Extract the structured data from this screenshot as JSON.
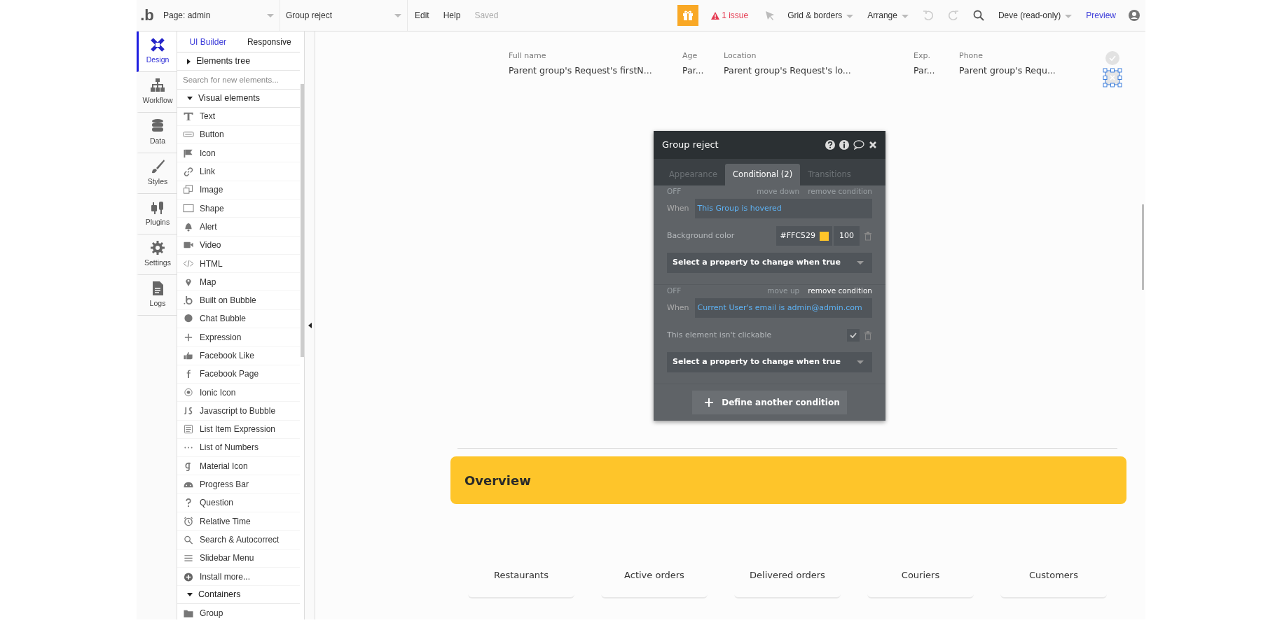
{
  "topbar": {
    "logo": ".b",
    "page": "Page: admin",
    "element": "Group reject",
    "menu": [
      "Edit",
      "Help"
    ],
    "saved": "Saved",
    "issues": "1 issue",
    "grid": "Grid & borders",
    "arrange": "Arrange",
    "user": "Deve (read-only)",
    "preview": "Preview"
  },
  "side_tabs": [
    {
      "label": "Design",
      "selected": true
    },
    {
      "label": "Workflow",
      "selected": false
    },
    {
      "label": "Data",
      "selected": false
    },
    {
      "label": "Styles",
      "selected": false
    },
    {
      "label": "Plugins",
      "selected": false
    },
    {
      "label": "Settings",
      "selected": false
    },
    {
      "label": "Logs",
      "selected": false
    }
  ],
  "panel_tabs": [
    {
      "label": "UI Builder",
      "selected": true
    },
    {
      "label": "Responsive",
      "selected": false
    }
  ],
  "elements_tree": {
    "label": "Elements tree",
    "expanded": false
  },
  "search": {
    "placeholder": "Search for new elements..."
  },
  "sections": [
    {
      "label": "Visual elements",
      "expanded": true,
      "items": [
        "Text",
        "Button",
        "Icon",
        "Link",
        "Image",
        "Shape",
        "Alert",
        "Video",
        "HTML",
        "Map",
        "Built on Bubble",
        "Chat Bubble",
        "Expression",
        "Facebook Like",
        "Facebook Page",
        "Ionic Icon",
        "Javascript to Bubble",
        "List Item Expression",
        "List of Numbers",
        "Material Icon",
        "Progress Bar",
        "Question",
        "Relative Time",
        "Search & Autocorrect",
        "Slidebar Menu",
        "Install more..."
      ]
    },
    {
      "label": "Containers",
      "expanded": true,
      "items": [
        "Group"
      ]
    }
  ],
  "columns": [
    {
      "label": "Full name",
      "value": "Parent group's Request's firstN..."
    },
    {
      "label": "Age",
      "value": "Par..."
    },
    {
      "label": "Location",
      "value": "Parent group's Request's lo..."
    },
    {
      "label": "Exp.",
      "value": "Par..."
    },
    {
      "label": "Phone",
      "value": "Parent group's Requ..."
    }
  ],
  "dialog": {
    "title": "Group reject",
    "tabs": [
      {
        "label": "Appearance",
        "selected": false
      },
      {
        "label": "Conditional (2)",
        "selected": true
      },
      {
        "label": "Transitions",
        "selected": false
      }
    ],
    "conditions": [
      {
        "state": "OFF",
        "move": "move down",
        "remove": "remove condition",
        "remove_hovered": false,
        "when_label": "When",
        "when": "This Group is hovered",
        "property": {
          "kind": "color",
          "label": "Background color",
          "value": "#FFC529",
          "color": "#ffc529",
          "opacity": "100"
        },
        "select": "Select a property to change when true"
      },
      {
        "state": "OFF",
        "move": "move up",
        "remove": "remove condition",
        "remove_hovered": true,
        "when_label": "When",
        "when": "Current User's email is admin@admin.com",
        "property": {
          "kind": "checkbox",
          "label": "This element isn't clickable",
          "checked": true
        },
        "select": "Select a property to change when true"
      }
    ],
    "add_button": "Define another condition"
  },
  "overview": "Overview",
  "stats": [
    "Restaurants",
    "Active orders",
    "Delivered orders",
    "Couriers",
    "Customers"
  ]
}
